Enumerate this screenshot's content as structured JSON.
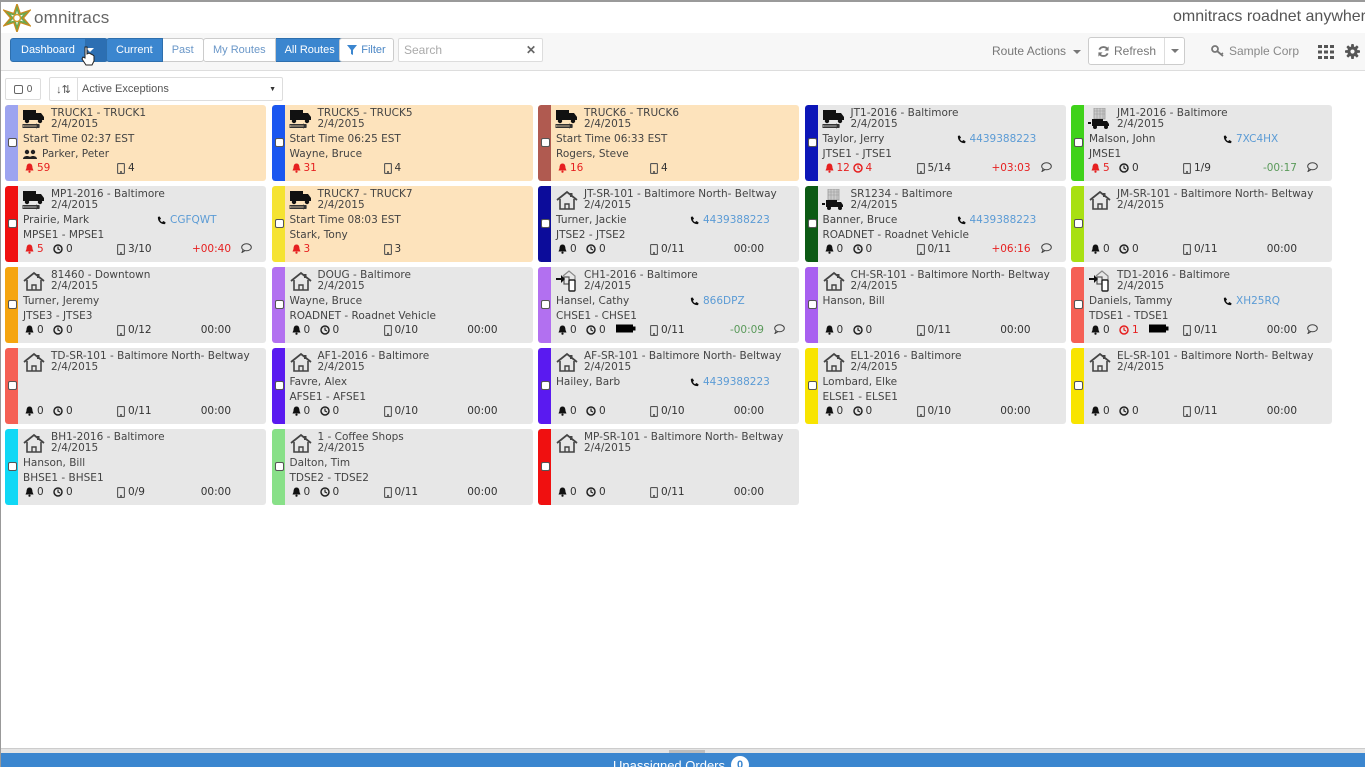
{
  "header": {
    "logo_text": "omnitracs",
    "app_title": "omnitracs roadnet anywher"
  },
  "toolbar": {
    "dashboard_label": "Dashboard",
    "time_filter": [
      {
        "label": "Current",
        "active": true
      },
      {
        "label": "Past",
        "active": false
      }
    ],
    "route_filter": [
      {
        "label": "My Routes",
        "active": false
      },
      {
        "label": "All Routes",
        "active": true
      }
    ],
    "filter_label": "Filter",
    "search_placeholder": "Search",
    "search_value": "",
    "route_actions_label": "Route Actions",
    "refresh_label": "Refresh",
    "org_label": "Sample Corp"
  },
  "subtoolbar": {
    "selected_count": "0",
    "sort_option": "Active Exceptions"
  },
  "cards": [
    {
      "title": "TRUCK1 - TRUCK1",
      "date": "2/4/2015",
      "line3": "Start Time 02:37 EST",
      "line4": "Parker, Peter",
      "line4_team": true,
      "phone": "",
      "alerts": "59",
      "alerts_red": true,
      "late": null,
      "stops": "4",
      "variance": "",
      "comment": false,
      "color": "#9da4f0",
      "exception": true,
      "icon": "truck"
    },
    {
      "title": "TRUCK5 - TRUCK5",
      "date": "2/4/2015",
      "line3": "Start Time 06:25 EST",
      "line4": "Wayne, Bruce",
      "phone": "",
      "alerts": "31",
      "alerts_red": true,
      "late": null,
      "stops": "4",
      "variance": "",
      "comment": false,
      "color": "#1a56f0",
      "exception": true,
      "icon": "truck"
    },
    {
      "title": "TRUCK6 - TRUCK6",
      "date": "2/4/2015",
      "line3": "Start Time 06:33 EST",
      "line4": "Rogers, Steve",
      "phone": "",
      "alerts": "16",
      "alerts_red": true,
      "late": null,
      "stops": "4",
      "variance": "",
      "comment": false,
      "color": "#b05a50",
      "exception": true,
      "icon": "truck"
    },
    {
      "title": "JT1-2016 - Baltimore",
      "date": "2/4/2015",
      "line3": "Taylor, Jerry",
      "line4": "JTSE1 - JTSE1",
      "phone": "4439388223",
      "alerts": "12",
      "alerts_red": true,
      "late": "4",
      "late_red": true,
      "stops": "5/14",
      "variance": "+03:03",
      "variance_color": "red",
      "comment": true,
      "color": "#0c16b8",
      "exception": false,
      "icon": "truck"
    },
    {
      "title": "JM1-2016 - Baltimore",
      "date": "2/4/2015",
      "line3": "Malson, John",
      "line4": "JMSE1",
      "phone": "7XC4HX",
      "alerts": "5",
      "alerts_red": true,
      "late": "0",
      "late_red": false,
      "stops": "1/9",
      "variance": "-00:17",
      "variance_color": "green",
      "comment": true,
      "color": "#3fd21a",
      "exception": false,
      "icon": "depot-truck"
    },
    {
      "title": "MP1-2016 - Baltimore",
      "date": "2/4/2015",
      "line3": "Prairie, Mark",
      "line4": "MPSE1 - MPSE1",
      "phone": "CGFQWT",
      "alerts": "5",
      "alerts_red": true,
      "late": "0",
      "late_red": false,
      "stops": "3/10",
      "variance": "+00:40",
      "variance_color": "red",
      "comment": true,
      "color": "#f01010",
      "exception": false,
      "icon": "truck"
    },
    {
      "title": "TRUCK7 - TRUCK7",
      "date": "2/4/2015",
      "line3": "Start Time 08:03 EST",
      "line4": "Stark, Tony",
      "phone": "",
      "alerts": "3",
      "alerts_red": true,
      "late": null,
      "stops": "3",
      "variance": "",
      "comment": false,
      "color": "#f5e332",
      "exception": true,
      "icon": "truck"
    },
    {
      "title": "JT-SR-101 - Baltimore North- Beltway",
      "date": "2/4/2015",
      "line3": "Turner, Jackie",
      "line4": "JTSE2 - JTSE2",
      "phone": "4439388223",
      "alerts": "0",
      "alerts_red": false,
      "late": "0",
      "late_red": false,
      "stops": "0/11",
      "variance": "00:00",
      "variance_color": "normal",
      "comment": false,
      "color": "#0c0c9a",
      "exception": false,
      "icon": "home"
    },
    {
      "title": "SR1234 - Baltimore",
      "date": "2/4/2015",
      "line3": "Banner, Bruce",
      "line4": "ROADNET - Roadnet Vehicle",
      "phone": "4439388223",
      "alerts": "0",
      "alerts_red": false,
      "late": "0",
      "late_red": false,
      "stops": "0/11",
      "variance": "+06:16",
      "variance_color": "red",
      "comment": true,
      "color": "#0c5a14",
      "exception": false,
      "icon": "depot-truck"
    },
    {
      "title": "JM-SR-101 - Baltimore North- Beltway",
      "date": "2/4/2015",
      "line3": "",
      "line4": "",
      "phone": "",
      "alerts": "0",
      "alerts_red": false,
      "late": "0",
      "late_red": false,
      "stops": "0/11",
      "variance": "00:00",
      "variance_color": "normal",
      "comment": false,
      "color": "#a8e012",
      "exception": false,
      "icon": "home"
    },
    {
      "title": "81460 - Downtown",
      "date": "2/4/2015",
      "line3": "Turner, Jeremy",
      "line4": "JTSE3 - JTSE3",
      "phone": "",
      "alerts": "0",
      "alerts_red": false,
      "late": "0",
      "late_red": false,
      "stops": "0/12",
      "variance": "00:00",
      "variance_color": "normal",
      "comment": false,
      "color": "#f5a510",
      "exception": false,
      "icon": "home"
    },
    {
      "title": "DOUG - Baltimore",
      "date": "2/4/2015",
      "line3": "Wayne, Bruce",
      "line4": "ROADNET - Roadnet Vehicle",
      "phone": "",
      "alerts": "0",
      "alerts_red": false,
      "late": "0",
      "late_red": false,
      "stops": "0/10",
      "variance": "00:00",
      "variance_color": "normal",
      "comment": false,
      "color": "#b270f0",
      "exception": false,
      "icon": "home"
    },
    {
      "title": "CH1-2016 - Baltimore",
      "date": "2/4/2015",
      "line3": "Hansel, Cathy",
      "line4": "CHSE1 - CHSE1",
      "phone": "866DPZ",
      "alerts": "0",
      "alerts_red": false,
      "late": "0",
      "late_red": false,
      "battery": true,
      "stops": "0/11",
      "variance": "-00:09",
      "variance_color": "green",
      "comment": true,
      "color": "#b270f0",
      "exception": false,
      "icon": "mobile-depot"
    },
    {
      "title": "CH-SR-101 - Baltimore North- Beltway",
      "date": "2/4/2015",
      "line3": "Hanson, Bill",
      "line4": "",
      "phone": "",
      "alerts": "0",
      "alerts_red": false,
      "late": "0",
      "late_red": false,
      "stops": "0/11",
      "variance": "00:00",
      "variance_color": "normal",
      "comment": false,
      "color": "#a860f0",
      "exception": false,
      "icon": "home"
    },
    {
      "title": "TD1-2016 - Baltimore",
      "date": "2/4/2015",
      "line3": "Daniels, Tammy",
      "line4": "TDSE1 - TDSE1",
      "phone": "XH25RQ",
      "alerts": "0",
      "alerts_red": false,
      "late": "1",
      "late_red": true,
      "battery": true,
      "stops": "0/11",
      "variance": "00:00",
      "variance_color": "normal",
      "comment": true,
      "color": "#f56055",
      "exception": false,
      "icon": "mobile-depot"
    },
    {
      "title": "TD-SR-101 - Baltimore North- Beltway",
      "date": "2/4/2015",
      "line3": "",
      "line4": "",
      "phone": "",
      "alerts": "0",
      "alerts_red": false,
      "late": "0",
      "late_red": false,
      "stops": "0/11",
      "variance": "00:00",
      "variance_color": "normal",
      "comment": false,
      "color": "#f56055",
      "exception": false,
      "icon": "home"
    },
    {
      "title": "AF1-2016 - Baltimore",
      "date": "2/4/2015",
      "line3": "Favre, Alex",
      "line4": "AFSE1 - AFSE1",
      "phone": "",
      "alerts": "0",
      "alerts_red": false,
      "late": "0",
      "late_red": false,
      "stops": "0/10",
      "variance": "00:00",
      "variance_color": "normal",
      "comment": false,
      "color": "#5a1af0",
      "exception": false,
      "icon": "home"
    },
    {
      "title": "AF-SR-101 - Baltimore North- Beltway",
      "date": "2/4/2015",
      "line3": "Hailey, Barb",
      "line4": "",
      "phone": "4439388223",
      "alerts": "0",
      "alerts_red": false,
      "late": "0",
      "late_red": false,
      "stops": "0/10",
      "variance": "00:00",
      "variance_color": "normal",
      "comment": false,
      "color": "#5a1af0",
      "exception": false,
      "icon": "home"
    },
    {
      "title": "EL1-2016 - Baltimore",
      "date": "2/4/2015",
      "line3": "Lombard, Elke",
      "line4": "ELSE1 - ELSE1",
      "phone": "",
      "alerts": "0",
      "alerts_red": false,
      "late": "0",
      "late_red": false,
      "stops": "0/10",
      "variance": "00:00",
      "variance_color": "normal",
      "comment": false,
      "color": "#f8e400",
      "exception": false,
      "icon": "home"
    },
    {
      "title": "EL-SR-101 - Baltimore North- Beltway",
      "date": "2/4/2015",
      "line3": "",
      "line4": "",
      "phone": "",
      "alerts": "0",
      "alerts_red": false,
      "late": "0",
      "late_red": false,
      "stops": "0/11",
      "variance": "00:00",
      "variance_color": "normal",
      "comment": false,
      "color": "#f8e400",
      "exception": false,
      "icon": "home"
    },
    {
      "title": "BH1-2016 - Baltimore",
      "date": "2/4/2015",
      "line3": "Hanson, Bill",
      "line4": "BHSE1 - BHSE1",
      "phone": "",
      "alerts": "0",
      "alerts_red": false,
      "late": "0",
      "late_red": false,
      "stops": "0/9",
      "variance": "00:00",
      "variance_color": "normal",
      "comment": false,
      "color": "#10d8f5",
      "exception": false,
      "icon": "home"
    },
    {
      "title": "1 - Coffee Shops",
      "date": "2/4/2015",
      "line3": "Dalton, Tim",
      "line4": "TDSE2 - TDSE2",
      "phone": "",
      "alerts": "0",
      "alerts_red": false,
      "late": "0",
      "late_red": false,
      "stops": "0/11",
      "variance": "00:00",
      "variance_color": "normal",
      "comment": false,
      "color": "#88e088",
      "exception": false,
      "icon": "home"
    },
    {
      "title": "MP-SR-101 - Baltimore North- Beltway",
      "date": "2/4/2015",
      "line3": "",
      "line4": "",
      "phone": "",
      "alerts": "0",
      "alerts_red": false,
      "late": "0",
      "late_red": false,
      "stops": "0/11",
      "variance": "00:00",
      "variance_color": "normal",
      "comment": false,
      "color": "#f01010",
      "exception": false,
      "icon": "home"
    }
  ],
  "footer": {
    "unassigned_label": "Unassigned Orders",
    "unassigned_count": "0"
  }
}
